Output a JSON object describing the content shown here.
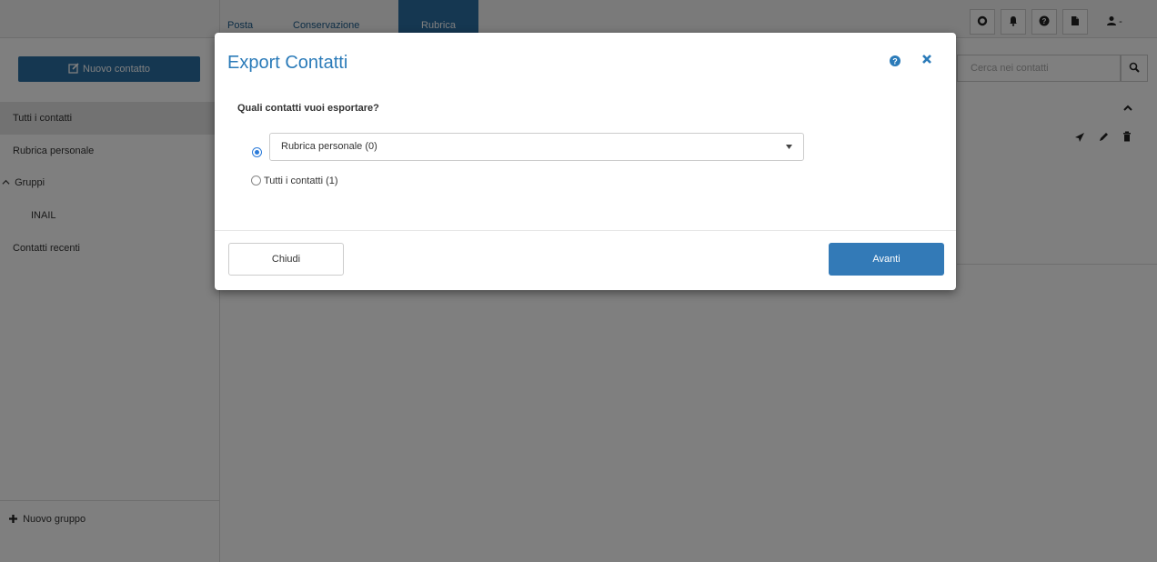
{
  "nav": {
    "tabs": [
      {
        "label": "Posta"
      },
      {
        "label": "Conservazione"
      },
      {
        "label": "Rubrica"
      }
    ],
    "icons": [
      "gear-icon",
      "bell-icon",
      "help-icon",
      "document-icon",
      "user-menu-icon"
    ],
    "user_menu_caret": "-"
  },
  "sidebar": {
    "new_contact_label": "Nuovo contatto",
    "items": [
      {
        "label": "Tutti i contatti"
      },
      {
        "label": "Rubrica personale"
      },
      {
        "label": "Gruppi"
      },
      {
        "label": "INAIL"
      },
      {
        "label": "Contatti recenti"
      }
    ],
    "new_group_label": "Nuovo gruppo"
  },
  "search": {
    "placeholder": "Cerca nei contatti"
  },
  "modal": {
    "title": "Export Contatti",
    "question": "Quali contatti vuoi esportare?",
    "options": [
      {
        "label": "Rubrica personale (0)",
        "selected": true
      },
      {
        "label": "Tutti i contatti (1)",
        "selected": false
      }
    ],
    "close_label": "Chiudi",
    "next_label": "Avanti"
  },
  "colors": {
    "accent": "#2b6ea3",
    "title": "#2b7bb9",
    "primary_button": "#337ab7"
  }
}
